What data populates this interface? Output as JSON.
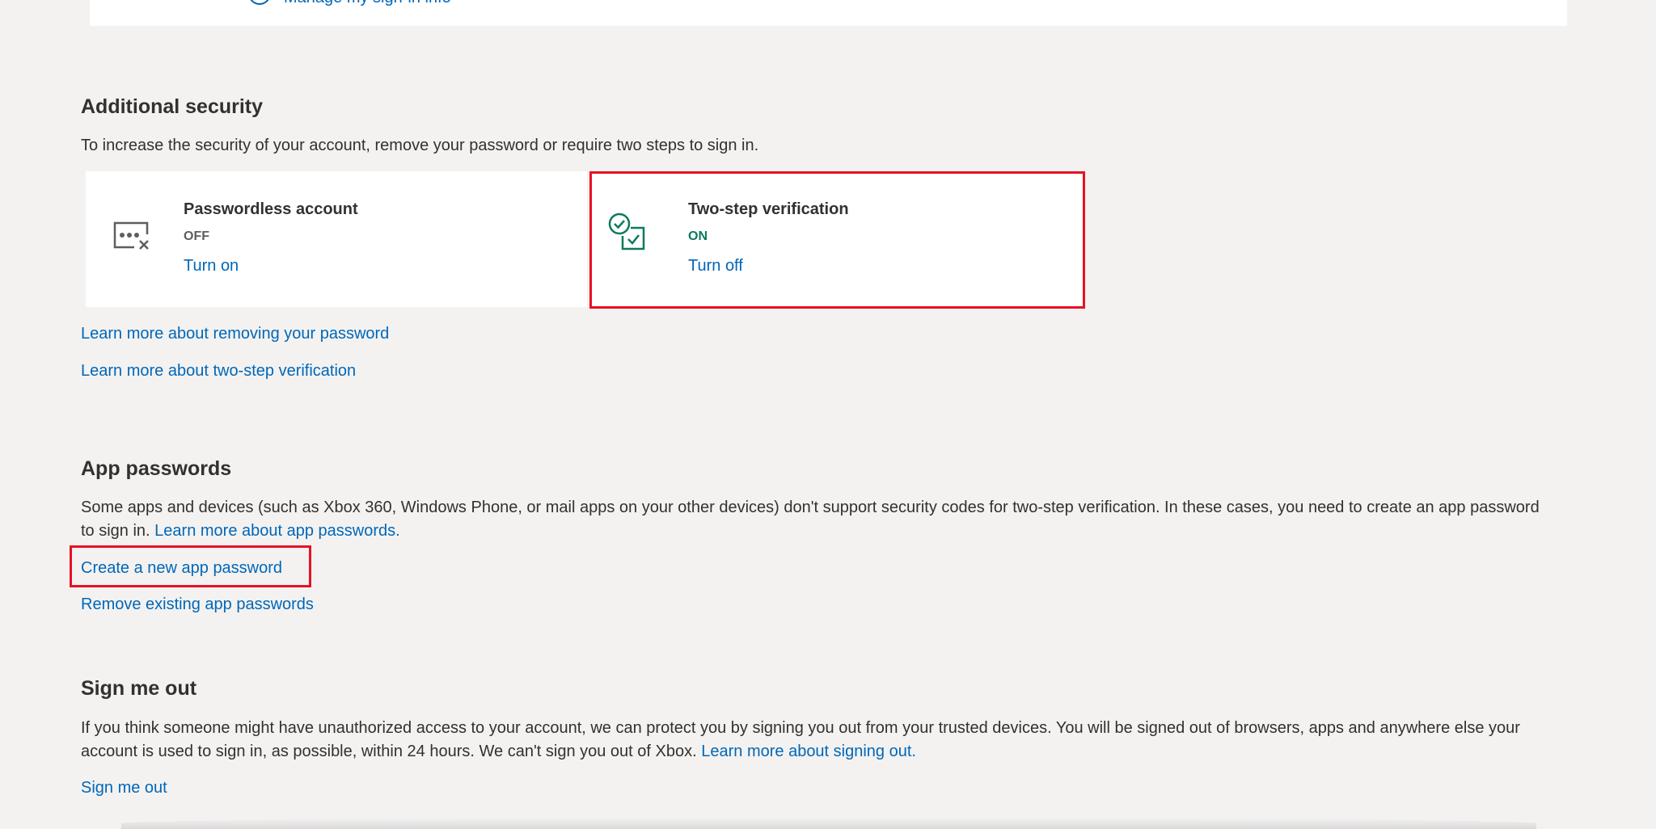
{
  "top_panel": {
    "partial_link": "Manage my sign-in info"
  },
  "additional_security": {
    "title": "Additional security",
    "description": "To increase the security of your account, remove your password or require two steps to sign in.",
    "cards": [
      {
        "title": "Passwordless account",
        "status": "OFF",
        "action": "Turn on",
        "icon": "password-dots-x-icon"
      },
      {
        "title": "Two-step verification",
        "status": "ON",
        "action": "Turn off",
        "icon": "two-step-check-icon"
      }
    ],
    "links": [
      "Learn more about removing your password",
      "Learn more about two-step verification"
    ]
  },
  "app_passwords": {
    "title": "App passwords",
    "description": "Some apps and devices (such as Xbox 360, Windows Phone, or mail apps on your other devices) don't support security codes for two-step verification. In these cases, you need to create an app password to sign in.",
    "inline_link": "Learn more about app passwords.",
    "create_link": "Create a new app password",
    "remove_link": "Remove existing app passwords"
  },
  "sign_me_out": {
    "title": "Sign me out",
    "description": "If you think someone might have unauthorized access to your account, we can protect you by signing you out from your trusted devices. You will be signed out of browsers, apps and anywhere else your account is used to sign in, as possible, within 24 hours. We can't sign you out of Xbox.",
    "inline_link": "Learn more about signing out.",
    "action_link": "Sign me out"
  },
  "colors": {
    "background": "#f3f2f1",
    "link": "#0067b8",
    "on_status": "#0b7a5e",
    "highlight": "#e81123"
  }
}
